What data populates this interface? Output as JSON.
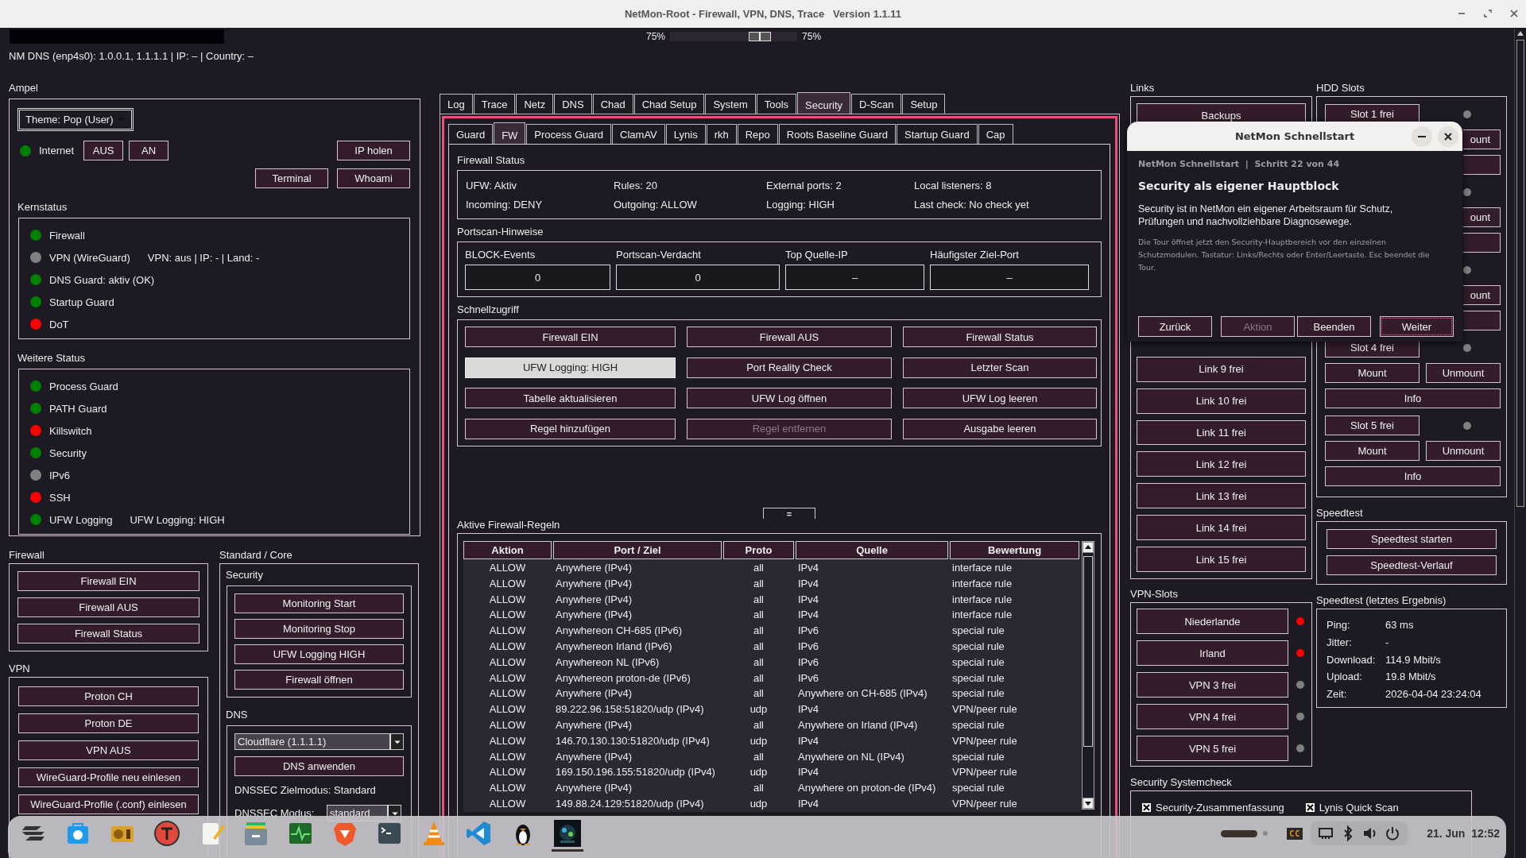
{
  "window": {
    "title": "NetMon-Root - Firewall, VPN, DNS, Trace   Version 1.1.11"
  },
  "zoom": {
    "left_reading": "75%",
    "level": 0.75,
    "right_reading": "75%"
  },
  "dns_line": "NM DNS (enp4s0): 1.0.0.1, 1.1.1.1 | IP: – | Country: –",
  "ampel": {
    "title": "Ampel",
    "theme": "Theme: Pop (User)",
    "internet": {
      "label": "Internet",
      "color": "#008000"
    },
    "internet_buttons": [
      "AUS",
      "AN"
    ],
    "ip_button": "IP holen",
    "tool_buttons": [
      "Terminal",
      "Whoami"
    ],
    "groups": [
      {
        "title": "Kernstatus",
        "items": [
          {
            "label": "Firewall",
            "color": "#008000"
          },
          {
            "label": "VPN (WireGuard)",
            "detail": "VPN: aus | IP: - | Land: -",
            "color": "#808080"
          },
          {
            "label": "DNS Guard: aktiv (OK)",
            "color": "#008000"
          },
          {
            "label": "Startup Guard",
            "color": "#008000"
          },
          {
            "label": "DoT",
            "color": "#ff0000"
          }
        ]
      },
      {
        "title": "Weitere Status",
        "items": [
          {
            "label": "Process Guard",
            "color": "#008000"
          },
          {
            "label": "PATH Guard",
            "color": "#008000"
          },
          {
            "label": "Killswitch",
            "color": "#ff0000"
          },
          {
            "label": "Security",
            "color": "#008000"
          },
          {
            "label": "IPv6",
            "color": "#808080"
          },
          {
            "label": "SSH",
            "color": "#ff0000"
          },
          {
            "label": "UFW Logging",
            "detail": "UFW Logging: HIGH",
            "color": "#008000"
          }
        ]
      }
    ]
  },
  "firewall_panel": {
    "title": "Firewall",
    "buttons": [
      "Firewall EIN",
      "Firewall AUS",
      "Firewall Status"
    ]
  },
  "vpn_panel": {
    "title": "VPN",
    "buttons": [
      "Proton CH",
      "Proton DE",
      "VPN AUS",
      "WireGuard-Profile neu einlesen",
      "WireGuard-Profile (.conf) einlesen"
    ]
  },
  "core": {
    "title": "Standard / Core",
    "security": {
      "title": "Security",
      "buttons": [
        "Monitoring Start",
        "Monitoring Stop",
        "UFW Logging HIGH",
        "Firewall öffnen"
      ]
    },
    "dns": {
      "title": "DNS",
      "resolver": "Cloudflare (1.1.1.1)",
      "apply": "DNS anwenden",
      "target_mode": "DNSSEC Zielmodus: Standard",
      "mode_label": "DNSSEC Modus:",
      "mode": "standard"
    }
  },
  "main_tabs": [
    {
      "label": "Log",
      "selected": false
    },
    {
      "label": "Trace",
      "selected": false
    },
    {
      "label": "Netz",
      "selected": false
    },
    {
      "label": "DNS",
      "selected": false
    },
    {
      "label": "Chad",
      "selected": false
    },
    {
      "label": "Chad Setup",
      "selected": false
    },
    {
      "label": "System",
      "selected": false
    },
    {
      "label": "Tools",
      "selected": false
    },
    {
      "label": "Security",
      "selected": true
    },
    {
      "label": "D-Scan",
      "selected": false
    },
    {
      "label": "Setup",
      "selected": false
    }
  ],
  "sub_tabs": [
    {
      "label": "Guard",
      "selected": false
    },
    {
      "label": "FW",
      "selected": true
    },
    {
      "label": "Process Guard",
      "selected": false
    },
    {
      "label": "ClamAV",
      "selected": false
    },
    {
      "label": "Lynis",
      "selected": false
    },
    {
      "label": "rkh",
      "selected": false
    },
    {
      "label": "Repo",
      "selected": false
    },
    {
      "label": "Roots Baseline Guard",
      "selected": false
    },
    {
      "label": "Startup Guard",
      "selected": false
    },
    {
      "label": "Cap",
      "selected": false
    }
  ],
  "firewall_status": {
    "title": "Firewall Status",
    "rows": [
      [
        "UFW: Aktiv",
        "Rules: 20",
        "External ports: 2",
        "Local listeners: 8"
      ],
      [
        "Incoming: DENY",
        "Outgoing: ALLOW",
        "Logging: HIGH",
        "Last check: No check yet"
      ]
    ]
  },
  "portscan": {
    "title": "Portscan-Hinweise",
    "fields": [
      {
        "label": "BLOCK-Events",
        "value": "0"
      },
      {
        "label": "Portscan-Verdacht",
        "value": "0"
      },
      {
        "label": "Top Quelle-IP",
        "value": "–"
      },
      {
        "label": "Häufigster Ziel-Port",
        "value": "–"
      }
    ]
  },
  "quick": {
    "title": "Schnellzugriff",
    "buttons": [
      {
        "label": "Firewall EIN",
        "pressed": false,
        "disabled": false
      },
      {
        "label": "Firewall AUS",
        "pressed": false,
        "disabled": false
      },
      {
        "label": "Firewall Status",
        "pressed": false,
        "disabled": false
      },
      {
        "label": "UFW Logging: HIGH",
        "pressed": true,
        "disabled": false
      },
      {
        "label": "Port Reality Check",
        "pressed": false,
        "disabled": false
      },
      {
        "label": "Letzter Scan",
        "pressed": false,
        "disabled": false
      },
      {
        "label": "Tabelle aktualisieren",
        "pressed": false,
        "disabled": false
      },
      {
        "label": "UFW Log öffnen",
        "pressed": false,
        "disabled": false
      },
      {
        "label": "UFW Log leeren",
        "pressed": false,
        "disabled": false
      },
      {
        "label": "Regel hinzufügen",
        "pressed": false,
        "disabled": false
      },
      {
        "label": "Regel entfernen",
        "pressed": false,
        "disabled": true
      },
      {
        "label": "Ausgabe leeren",
        "pressed": false,
        "disabled": false
      }
    ]
  },
  "sash": "=",
  "rules": {
    "title": "Aktive Firewall-Regeln",
    "columns": [
      "Aktion",
      "Port / Ziel",
      "Proto",
      "Quelle",
      "Bewertung"
    ],
    "rows": [
      [
        "ALLOW",
        "Anywhere (IPv4)",
        "all",
        "IPv4",
        "interface rule"
      ],
      [
        "ALLOW",
        "Anywhere (IPv4)",
        "all",
        "IPv4",
        "interface rule"
      ],
      [
        "ALLOW",
        "Anywhere (IPv4)",
        "all",
        "IPv4",
        "interface rule"
      ],
      [
        "ALLOW",
        "Anywhere (IPv4)",
        "all",
        "IPv4",
        "interface rule"
      ],
      [
        "ALLOW",
        "Anywhereon CH-685 (IPv6)",
        "all",
        "IPv6",
        "special rule"
      ],
      [
        "ALLOW",
        "Anywhereon Irland (IPv6)",
        "all",
        "IPv6",
        "special rule"
      ],
      [
        "ALLOW",
        "Anywhereon NL (IPv6)",
        "all",
        "IPv6",
        "special rule"
      ],
      [
        "ALLOW",
        "Anywhereon proton-de (IPv6)",
        "all",
        "IPv6",
        "special rule"
      ],
      [
        "ALLOW",
        "Anywhere (IPv4)",
        "all",
        "Anywhere on CH-685 (IPv4)",
        "special rule"
      ],
      [
        "ALLOW",
        "89.222.96.158:51820/udp (IPv4)",
        "udp",
        "IPv4",
        "VPN/peer rule"
      ],
      [
        "ALLOW",
        "Anywhere (IPv4)",
        "all",
        "Anywhere on Irland (IPv4)",
        "special rule"
      ],
      [
        "ALLOW",
        "146.70.130.130:51820/udp (IPv4)",
        "udp",
        "IPv4",
        "VPN/peer rule"
      ],
      [
        "ALLOW",
        "Anywhere (IPv4)",
        "all",
        "Anywhere on NL (IPv4)",
        "special rule"
      ],
      [
        "ALLOW",
        "169.150.196.155:51820/udp (IPv4)",
        "udp",
        "IPv4",
        "VPN/peer rule"
      ],
      [
        "ALLOW",
        "Anywhere (IPv4)",
        "all",
        "Anywhere on proton-de (IPv4)",
        "special rule"
      ],
      [
        "ALLOW",
        "149.88.24.129:51820/udp (IPv4)",
        "udp",
        "IPv4",
        "VPN/peer rule"
      ]
    ]
  },
  "links": {
    "title": "Links",
    "buttons": [
      "Backups",
      "Link 9 frei",
      "Link 10 frei",
      "Link 11 frei",
      "Link 12 frei",
      "Link 13 frei",
      "Link 14 frei",
      "Link 15 frei"
    ]
  },
  "vpn_slots": {
    "title": "VPN-Slots",
    "slots": [
      {
        "label": "Niederlande",
        "color": "#ff0000"
      },
      {
        "label": "Irland",
        "color": "#ff0000"
      },
      {
        "label": "VPN 3 frei",
        "color": "#808080"
      },
      {
        "label": "VPN 4 frei",
        "color": "#808080"
      },
      {
        "label": "VPN 5 frei",
        "color": "#808080"
      }
    ]
  },
  "systemcheck": {
    "title": "Security Systemcheck",
    "items": [
      {
        "label": "Security-Zusammenfassung",
        "checked": true
      },
      {
        "label": "Lynis Quick Scan",
        "checked": true
      }
    ]
  },
  "hdd": {
    "title": "HDD Slots",
    "slots": [
      {
        "label": "Slot 1 frei",
        "color": "#808080",
        "unmount": "ount"
      },
      {
        "color": "#808080",
        "unmount": "ount"
      },
      {
        "color": "#808080",
        "unmount": "ount"
      },
      {
        "label": "Slot 4 frei",
        "color": "#808080",
        "mount": "Mount",
        "unmount": "Unmount",
        "info": "Info"
      },
      {
        "label": "Slot 5 frei",
        "color": "#808080",
        "mount": "Mount",
        "unmount": "Unmount",
        "info": "Info"
      }
    ]
  },
  "speedtest": {
    "title": "Speedtest",
    "buttons": [
      "Speedtest starten",
      "Speedtest-Verlauf"
    ]
  },
  "speed_result": {
    "title": "Speedtest (letztes Ergebnis)",
    "rows": [
      {
        "label": "Ping:",
        "value": "63 ms"
      },
      {
        "label": "Jitter:",
        "value": "-"
      },
      {
        "label": "Download:",
        "value": "114.9 Mbit/s"
      },
      {
        "label": "Upload:",
        "value": "19.8 Mbit/s"
      },
      {
        "label": "Zeit:",
        "value": "2026-04-04 23:24:04"
      }
    ]
  },
  "dialog": {
    "title": "NetMon Schnellstart",
    "step": "NetMon Schnellstart  |  Schritt 22 von 44",
    "heading": "Security als eigener Hauptblock",
    "body": "Security ist in NetMon ein eigener Arbeitsraum für Schutz, Prüfungen und nachvollziehbare Diagnosewege.",
    "hint": "Die Tour öffnet jetzt den Security-Hauptbereich vor den einzelnen Schutzmodulen. Tastatur: Links/Rechts oder Enter/Leertaste. Esc beendet die Tour.",
    "buttons": [
      {
        "label": "Zurück",
        "disabled": false,
        "focused": false
      },
      {
        "label": "Aktion",
        "disabled": true,
        "focused": false
      },
      {
        "label": "Beenden",
        "disabled": false,
        "focused": false
      },
      {
        "label": "Weiter",
        "disabled": false,
        "focused": true
      }
    ]
  },
  "taskbar": {
    "apps": [
      {
        "kind": "zorin",
        "active": false
      },
      {
        "kind": "store",
        "active": false
      },
      {
        "kind": "radio",
        "active": false
      },
      {
        "kind": "font",
        "active": false
      },
      {
        "kind": "notes",
        "active": false
      },
      {
        "kind": "files",
        "active": false
      },
      {
        "kind": "monitor",
        "active": false
      },
      {
        "kind": "browser",
        "active": false
      },
      {
        "kind": "terminal",
        "active": false
      },
      {
        "kind": "vlc",
        "active": false
      },
      {
        "kind": "vscode",
        "active": false
      },
      {
        "kind": "penguin",
        "active": false
      },
      {
        "kind": "game",
        "active": true
      }
    ],
    "cc": "CC",
    "clock": "21. Jun  12:52"
  }
}
